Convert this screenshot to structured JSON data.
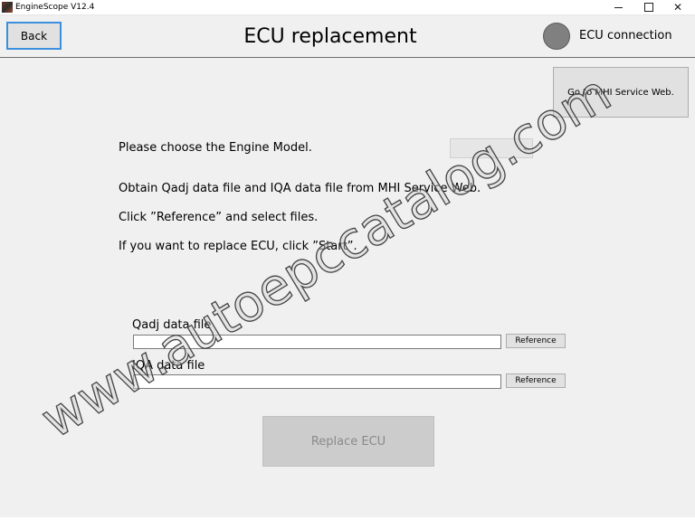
{
  "window": {
    "app_title": "EngineScope V12.4",
    "minimize_glyph": "",
    "maximize_glyph": "",
    "close_glyph": "✕"
  },
  "header": {
    "back_label": "Back",
    "page_title": "ECU replacement",
    "ecu_connection_label": "ECU connection",
    "ecu_indicator_color": "#808080"
  },
  "side": {
    "mhi_button_label": "Go to MHI Service Web."
  },
  "instructions": {
    "choose_engine": "Please choose the Engine Model.",
    "obtain_files": "Obtain Qadj data file and IQA data file from MHI Service Web.",
    "click_reference": "Click ”Reference” and select files.",
    "replace_start": "If you want to replace ECU, click ”Start”."
  },
  "engine_model_select": {
    "selected_value": "",
    "chevron": "⌄"
  },
  "files": {
    "qadj_label": "Qadj data file",
    "qadj_value": "",
    "iqa_label": "IQA data file",
    "iqa_value": "",
    "reference_label": "Reference"
  },
  "actions": {
    "replace_ecu_label": "Replace ECU"
  },
  "watermark": {
    "text": "www.autoepccatalog.com"
  },
  "colors": {
    "focus_border": "#3c8ede",
    "disabled_button_bg": "#cccccc",
    "disabled_text": "#8a8a8a"
  }
}
